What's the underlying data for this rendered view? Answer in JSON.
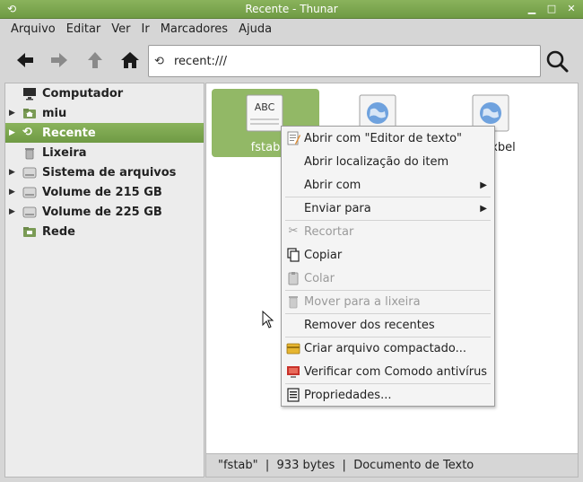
{
  "window": {
    "title": "Recente - Thunar",
    "app_icon": "recent-icon",
    "controls": [
      "minimize-icon",
      "maximize-icon",
      "close-icon"
    ]
  },
  "menubar": {
    "items": [
      "Arquivo",
      "Editar",
      "Ver",
      "Ir",
      "Marcadores",
      "Ajuda"
    ]
  },
  "toolbar": {
    "back_icon": "arrow-left-icon",
    "forward_icon": "arrow-right-icon",
    "up_icon": "arrow-up-icon",
    "home_icon": "home-icon",
    "location": "recent:///",
    "search_icon": "search-icon"
  },
  "sidebar": {
    "items": [
      {
        "label": "Computador",
        "expander": false,
        "icon": "monitor-icon",
        "selected": false
      },
      {
        "label": "miu",
        "expander": true,
        "icon": "home-folder-icon",
        "selected": false
      },
      {
        "label": "Recente",
        "expander": true,
        "icon": "recent-icon",
        "selected": true
      },
      {
        "label": "Lixeira",
        "expander": false,
        "icon": "trash-icon",
        "selected": false
      },
      {
        "label": "Sistema de arquivos",
        "expander": true,
        "icon": "drive-icon",
        "selected": false
      },
      {
        "label": "Volume de 215 GB",
        "expander": true,
        "icon": "drive-icon",
        "selected": false
      },
      {
        "label": "Volume de 225 GB",
        "expander": true,
        "icon": "drive-icon",
        "selected": false
      },
      {
        "label": "Rede",
        "expander": false,
        "icon": "network-icon",
        "selected": false
      }
    ]
  },
  "files": [
    {
      "name": "fstab",
      "icon": "text-file-icon",
      "selected": true,
      "icon_text": "ABC"
    },
    {
      "name": "",
      "icon": "web-file-icon",
      "selected": false
    },
    {
      "name": "ces.xbel",
      "icon": "web-file-icon",
      "selected": false
    }
  ],
  "context_menu": {
    "items": [
      {
        "label": "Abrir com \"Editor de texto\"",
        "icon": "text-editor-icon",
        "disabled": false,
        "submenu": false
      },
      {
        "label": "Abrir localização do item",
        "icon": "",
        "disabled": false,
        "submenu": false
      },
      {
        "label": "Abrir com",
        "icon": "",
        "disabled": false,
        "submenu": true
      },
      {
        "label": "Enviar para",
        "icon": "",
        "disabled": false,
        "submenu": true
      },
      {
        "label": "Recortar",
        "icon": "scissors-icon",
        "disabled": true,
        "submenu": false
      },
      {
        "label": "Copiar",
        "icon": "copy-icon",
        "disabled": false,
        "submenu": false
      },
      {
        "label": "Colar",
        "icon": "paste-icon",
        "disabled": true,
        "submenu": false
      },
      {
        "label": "Mover para a lixeira",
        "icon": "trash-icon",
        "disabled": true,
        "submenu": false
      },
      {
        "label": "Remover dos recentes",
        "icon": "",
        "disabled": false,
        "submenu": false
      },
      {
        "label": "Criar arquivo compactado...",
        "icon": "archive-icon",
        "disabled": false,
        "submenu": false
      },
      {
        "label": "Verificar com Comodo antivírus",
        "icon": "antivirus-icon",
        "disabled": false,
        "submenu": false
      },
      {
        "label": "Propriedades...",
        "icon": "properties-icon",
        "disabled": false,
        "submenu": false
      }
    ]
  },
  "statusbar": {
    "text": "\"fstab\"  |  933 bytes  |  Documento de Texto"
  }
}
